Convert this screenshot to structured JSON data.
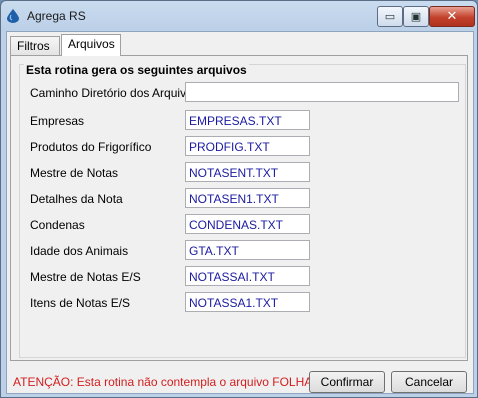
{
  "window": {
    "title": "Agrega RS",
    "min_glyph": "▭",
    "max_glyph": "▣",
    "close_glyph": "✕"
  },
  "tabs": [
    {
      "label": "Filtros",
      "active": false
    },
    {
      "label": "Arquivos",
      "active": true
    }
  ],
  "group": {
    "title": "Esta rotina gera os seguintes arquivos"
  },
  "form": {
    "directory": {
      "label": "Caminho Diretório dos Arquivos",
      "value": ""
    },
    "files": [
      {
        "label": "Empresas",
        "value": "EMPRESAS.TXT"
      },
      {
        "label": "Produtos do Frigorífico",
        "value": "PRODFIG.TXT"
      },
      {
        "label": "Mestre de Notas",
        "value": "NOTASENT.TXT"
      },
      {
        "label": "Detalhes da Nota",
        "value": "NOTASEN1.TXT"
      },
      {
        "label": "Condenas",
        "value": "CONDENAS.TXT"
      },
      {
        "label": "Idade dos Animais",
        "value": "GTA.TXT"
      },
      {
        "label": "Mestre de Notas E/S",
        "value": "NOTASSAI.TXT"
      },
      {
        "label": "Itens de Notas E/S",
        "value": "NOTASSA1.TXT"
      }
    ]
  },
  "footer": {
    "warning": "ATENÇÃO: Esta rotina não contempla o arquivo FOLHA.TXT.",
    "confirm_label": "Confirmar",
    "cancel_label": "Cancelar"
  },
  "colors": {
    "warning": "#d21e1e",
    "field_text": "#1a1aa0",
    "close_button": "#c2412c"
  }
}
